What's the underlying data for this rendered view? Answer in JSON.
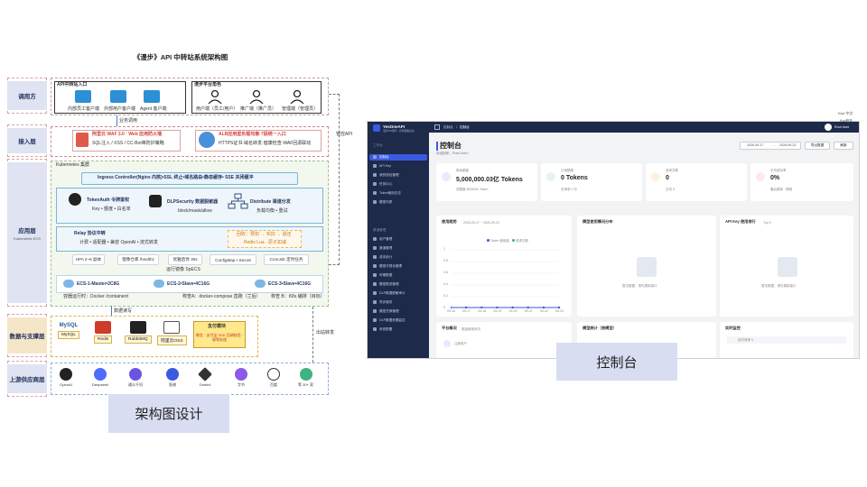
{
  "diagram": {
    "title": "《漫步》API 中转站系统架构图",
    "caption": "架构图设计",
    "lanes": [
      {
        "label": "调用方",
        "sub": ""
      },
      {
        "label": "接入层",
        "sub": ""
      },
      {
        "label": "应用层",
        "sub": "Kubernetes ECS"
      },
      {
        "label": "数据与支撑层",
        "sub": ""
      },
      {
        "label": "上游供应商层",
        "sub": ""
      }
    ],
    "callers": {
      "api_group_title": "API中转站入口",
      "api_entries": [
        "内部员工客户端",
        "外部用户客户端",
        "Agent 客户端"
      ],
      "role_group_title": "漫步平台角色",
      "roles": [
        "用户端（员工/用户）",
        "推广端（推广员）",
        "管理端（管理员）"
      ]
    },
    "link_service": "业务调用",
    "link_api": "管控API",
    "access": {
      "waf_title": "阿里云 WAF 3.0 · Web 应用防火墙",
      "waf_sub": "SQL注入 / XSS / CC-Bot等防护策略",
      "alb_title": "ALB应用型负载均衡·7层统一入口",
      "alb_sub": "HTTPS证书·域名转发·健康检查·WAF回源联动"
    },
    "k8s": {
      "cluster_label": "Kubernetes 集群",
      "ingress": "Ingress Controller(Nginx 内核)•SSL 终止•域名路由•静态缓存• SSE 关闭缓冲",
      "token_auth_title": "TokenAuth 令牌鉴权",
      "token_auth_sub": "Key • 额度 • 白名单",
      "dlp_title": "DLPSecurity 数据脱敏器",
      "dlp_sub": "block/mask/allow",
      "distribute_title": "Distribute 渠道分发",
      "distribute_sub": "负载均衡 • 重试",
      "relay_title": "Relay 协议中转",
      "relay_sub": "计费 • 适配器 • 兼容 OpenAI • 流式转发",
      "feedback_title": "回收：预扣 → 实扣 → 退还",
      "feedback_sub": "Redis Lua · 原子扣减",
      "chips": [
        "HPA 2~6 副本",
        "镜像仓库 /healthz",
        "优雅启停 30s",
        "ConfigMap • Secret",
        "CronJob 定时任务"
      ],
      "runtime_label": "运行镜像",
      "runtime_value": "SpECS",
      "ecs": [
        "ECS-1-Master•2C8G",
        "ECS-2•Slave•4C16G",
        "ECS-3•Slave•4C16G"
      ],
      "deploy_notes": [
        "容器运行时：Docker /containerd",
        "称查A：docker-compose 直跑（兰后）",
        "称查 B：K8s 编排（目标）"
      ]
    },
    "link_data": "数据读写",
    "link_upstream": "出站转发",
    "data": {
      "stores": [
        "MySQL",
        "Redis",
        "RabbitMQ",
        "阿里云OSS"
      ],
      "payment_title": "支付模块",
      "payment_sub": "微信 · 支付宝 SDK 回调校验 · 幂等处理"
    },
    "upstream": {
      "providers": [
        "OpenAI",
        "Deepseek",
        "通义千问",
        "智谱",
        "Gemini",
        "字节",
        "百度"
      ],
      "more": "等 30+ 家"
    }
  },
  "dashboard": {
    "caption": "控制台",
    "app_name": "YesOneAPI",
    "app_sub": "漫步API服务 · 控制面板后台",
    "topbar_right": "Root User",
    "breadcrumb": [
      "控制台",
      "控制台"
    ],
    "header_title": "控制台",
    "welcome": "欢迎回来，Root User！",
    "date_from": "2026-09-17",
    "date_to": "2026-09-23",
    "btn_export": "导出数据",
    "btn_refresh": "刷新",
    "sidebar_groups": [
      "工作台",
      "渠道管理"
    ],
    "sidebar_items": [
      "控制台",
      "API Key",
      "我的钱包管理",
      "任务中心",
      "Token使用日志",
      "模型列表",
      "用户管理",
      "渠道管理",
      "成本统计",
      "模型可视化管理",
      "时期数据",
      "模型限流管理",
      "DLP数据脱敏审计",
      "异步服务",
      "模型兑换管理",
      "DLP数据泄漏监控",
      "系统配置"
    ],
    "stat_cards": [
      {
        "label": "剩余额度",
        "value": "5,000,000.03亿 Tokens",
        "sub": "总额度 5000000 Token"
      },
      {
        "label": "已用额度",
        "value": "0 Tokens",
        "sub": "总请求 0 次"
      },
      {
        "label": "请求次数",
        "value": "0",
        "sub": "日均 0"
      },
      {
        "label": "平均成功率",
        "value": "0%",
        "sub": "最后更新 · 刚刚"
      }
    ],
    "panels": [
      {
        "title": "使用趋势",
        "sub": "2026-09-17 ~ 2026-09-23"
      },
      {
        "title": "模型使用情况分布",
        "sub": ""
      },
      {
        "title": "API Key 使用排行",
        "sub": "Top 5"
      }
    ],
    "trend_legend": [
      "Token 使用量",
      "请求次数"
    ],
    "trend_y": [
      "1",
      "0.8",
      "0.6",
      "0.4",
      "0.2",
      "0"
    ],
    "trend_x": [
      "09-16",
      "09-17",
      "09-18",
      "09-19",
      "09-20",
      "09-21",
      "09-22",
      "09-23"
    ],
    "empty_text": "暂无数据，请先调用接口",
    "bottom_panels": [
      "平台概况",
      "模型统计（按模型）",
      "实时监控"
    ],
    "bottom_sub": [
      "按量使用状况",
      "",
      ""
    ],
    "user_row": "注册用户",
    "realtime_row": "实时请求 0",
    "top_right_note": "Kiwi 中文",
    "login_note": "Kiwi登录"
  }
}
